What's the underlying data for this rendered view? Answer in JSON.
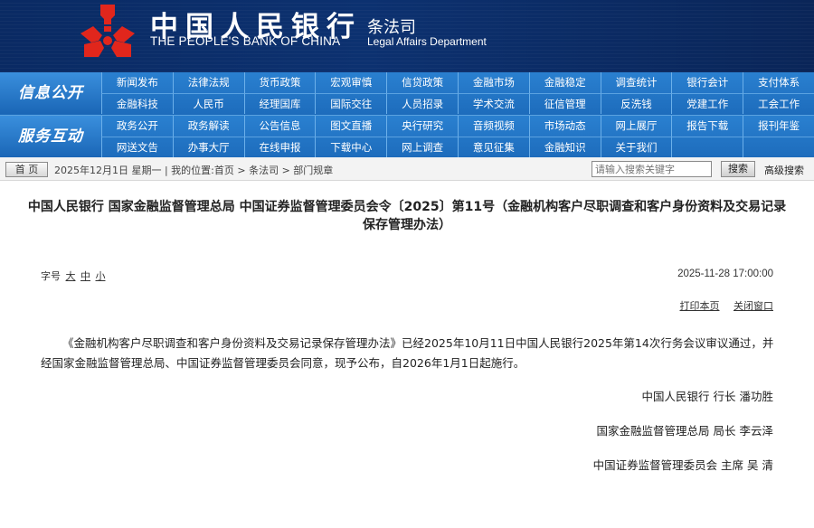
{
  "header": {
    "bank_name_cn": "中国人民银行",
    "bank_name_en": "THE PEOPLE'S BANK OF CHINA",
    "dept_cn": "条法司",
    "dept_en": "Legal Affairs Department",
    "logo_color": "#e1261c",
    "banner_color": "#0c3170"
  },
  "nav": {
    "group1_label": "信息公开",
    "group2_label": "服务互动",
    "group1_items": [
      "新闻发布",
      "法律法规",
      "货币政策",
      "宏观审慎",
      "信贷政策",
      "金融市场",
      "金融稳定",
      "调查统计",
      "银行会计",
      "支付体系",
      "金融科技",
      "人民币",
      "经理国库",
      "国际交往",
      "人员招录",
      "学术交流",
      "征信管理",
      "反洗钱",
      "党建工作",
      "工会工作"
    ],
    "group2_items": [
      "政务公开",
      "政务解读",
      "公告信息",
      "图文直播",
      "央行研究",
      "音频视频",
      "市场动态",
      "网上展厅",
      "报告下载",
      "报刊年鉴",
      "网送文告",
      "办事大厅",
      "在线申报",
      "下载中心",
      "网上调查",
      "意见征集",
      "金融知识",
      "关于我们",
      "",
      ""
    ],
    "accent_color": "#1f6fc0"
  },
  "breadcrumb": {
    "home_label": "首 页",
    "text": "2025年12月1日 星期一 | 我的位置:首页 > 条法司 > 部门规章",
    "search_placeholder": "请输入搜索关键字",
    "search_button": "搜索",
    "advanced_search": "高级搜索"
  },
  "article": {
    "title_line1": "中国人民银行 国家金融监督管理总局 中国证券监督管理委员会令〔2025〕第11号（金融机构客户尽职调查和客户身份资料及交易记录",
    "title_line2": "保存管理办法）",
    "font_size_label": "字号",
    "font_size_large": "大",
    "font_size_medium": "中",
    "font_size_small": "小",
    "date": "2025-11-28 17:00:00",
    "print_label": "打印本页",
    "close_label": "关闭窗口",
    "body": "《金融机构客户尽职调查和客户身份资料及交易记录保存管理办法》已经2025年10月11日中国人民银行2025年第14次行务会议审议通过，并经国家金融监督管理总局、中国证券监督管理委员会同意，现予公布，自2026年1月1日起施行。",
    "signatures": [
      "中国人民银行 行长  潘功胜",
      "国家金融监督管理总局 局长  李云泽",
      "中国证券监督管理委员会 主席  吴  清"
    ]
  }
}
